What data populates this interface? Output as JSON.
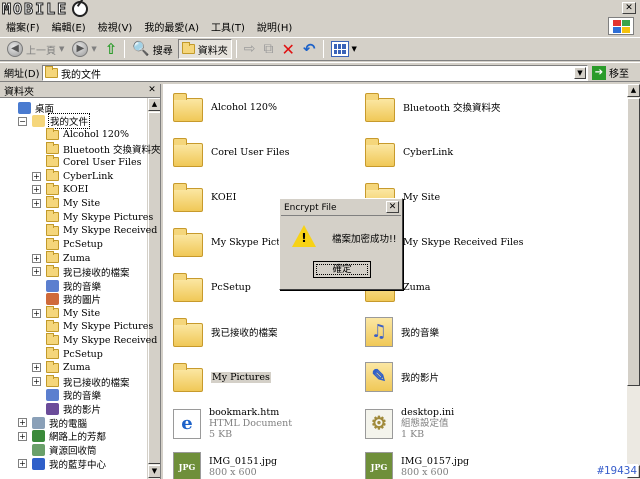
{
  "watermark": "MOBILE",
  "menu": [
    "檔案(F)",
    "編輯(E)",
    "檢視(V)",
    "我的最愛(A)",
    "工具(T)",
    "說明(H)"
  ],
  "toolbar": {
    "back_label": "上一頁",
    "search_label": "搜尋",
    "folders_label": "資料夾"
  },
  "address": {
    "label": "網址(D)",
    "value": "我的文件",
    "go_label": "移至"
  },
  "left_pane": {
    "title": "資料夾",
    "tree": [
      {
        "label": "桌面",
        "icon": "desktop",
        "expander": "",
        "indent": 0
      },
      {
        "label": "我的文件",
        "icon": "folder-doc",
        "expander": "−",
        "indent": 1,
        "selected": true
      },
      {
        "label": "Alcohol 120%",
        "icon": "folder",
        "expander": "",
        "indent": 2
      },
      {
        "label": "Bluetooth 交換資料夾",
        "icon": "folder",
        "expander": "",
        "indent": 2
      },
      {
        "label": "Corel User Files",
        "icon": "folder",
        "expander": "",
        "indent": 2
      },
      {
        "label": "CyberLink",
        "icon": "folder",
        "expander": "+",
        "indent": 2
      },
      {
        "label": "KOEI",
        "icon": "folder",
        "expander": "+",
        "indent": 2
      },
      {
        "label": "My Site",
        "icon": "folder",
        "expander": "+",
        "indent": 2
      },
      {
        "label": "My Skype Pictures",
        "icon": "folder",
        "expander": "",
        "indent": 2
      },
      {
        "label": "My Skype Received Files",
        "icon": "folder",
        "expander": "",
        "indent": 2
      },
      {
        "label": "PcSetup",
        "icon": "folder",
        "expander": "",
        "indent": 2
      },
      {
        "label": "Zuma",
        "icon": "folder",
        "expander": "+",
        "indent": 2
      },
      {
        "label": "我已接收的檔案",
        "icon": "folder",
        "expander": "+",
        "indent": 2
      },
      {
        "label": "我的音樂",
        "icon": "music",
        "expander": "",
        "indent": 2
      },
      {
        "label": "我的圖片",
        "icon": "picture",
        "expander": "",
        "indent": 2
      },
      {
        "label": "My Site",
        "icon": "folder",
        "expander": "+",
        "indent": 2
      },
      {
        "label": "My Skype Pictures",
        "icon": "folder",
        "expander": "",
        "indent": 2
      },
      {
        "label": "My Skype Received Files",
        "icon": "folder",
        "expander": "",
        "indent": 2
      },
      {
        "label": "PcSetup",
        "icon": "folder",
        "expander": "",
        "indent": 2
      },
      {
        "label": "Zuma",
        "icon": "folder",
        "expander": "+",
        "indent": 2
      },
      {
        "label": "我已接收的檔案",
        "icon": "folder",
        "expander": "+",
        "indent": 2
      },
      {
        "label": "我的音樂",
        "icon": "music",
        "expander": "",
        "indent": 2
      },
      {
        "label": "我的影片",
        "icon": "video",
        "expander": "",
        "indent": 2
      },
      {
        "label": "我的電腦",
        "icon": "computer",
        "expander": "+",
        "indent": 1
      },
      {
        "label": "網路上的芳鄰",
        "icon": "network",
        "expander": "+",
        "indent": 1
      },
      {
        "label": "資源回收筒",
        "icon": "recycle",
        "expander": "",
        "indent": 1
      },
      {
        "label": "我的藍芽中心",
        "icon": "bluetooth",
        "expander": "+",
        "indent": 1
      }
    ]
  },
  "right_pane": {
    "items": [
      {
        "name": "Alcohol 120%",
        "icon": "folder",
        "lines": []
      },
      {
        "name": "Bluetooth 交換資料夾",
        "icon": "folder",
        "lines": []
      },
      {
        "name": "Corel User Files",
        "icon": "folder",
        "lines": []
      },
      {
        "name": "CyberLink",
        "icon": "folder",
        "lines": []
      },
      {
        "name": "KOEI",
        "icon": "folder",
        "lines": []
      },
      {
        "name": "My Site",
        "icon": "folder",
        "lines": []
      },
      {
        "name": "My Skype Picture",
        "icon": "folder",
        "lines": []
      },
      {
        "name": "My Skype Received Files",
        "icon": "folder",
        "lines": []
      },
      {
        "name": "PcSetup",
        "icon": "folder",
        "lines": []
      },
      {
        "name": "Zuma",
        "icon": "folder",
        "lines": []
      },
      {
        "name": "我已接收的檔案",
        "icon": "folder",
        "lines": []
      },
      {
        "name": "我的音樂",
        "icon": "music-folder",
        "lines": []
      },
      {
        "name": "My Pictures",
        "icon": "folder",
        "lines": []
      },
      {
        "name": "我的影片",
        "icon": "video-folder",
        "lines": []
      },
      {
        "name": "bookmark.htm",
        "icon": "ie-document",
        "lines": [
          "HTML Document",
          "5 KB"
        ]
      },
      {
        "name": "desktop.ini",
        "icon": "ini-file",
        "lines": [
          "組態設定值",
          "1 KB"
        ]
      },
      {
        "name": "IMG_0151.jpg",
        "icon": "jpg-file",
        "lines": [
          "800 x 600"
        ]
      },
      {
        "name": "IMG_0157.jpg",
        "icon": "jpg-file",
        "lines": [
          "800 x 600"
        ]
      }
    ]
  },
  "dialog": {
    "title": "Encrypt File",
    "message": "檔案加密成功!!",
    "ok_label": "確定"
  },
  "corner_tag": "#19434"
}
